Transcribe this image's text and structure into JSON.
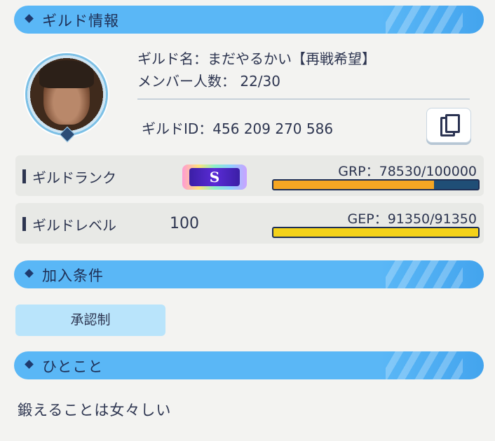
{
  "sections": {
    "guild_info_title": "ギルド情報",
    "join_condition_title": "加入条件",
    "comment_title": "ひとこと"
  },
  "guild": {
    "name_line": "ギルド名：まだやるかい【再戦希望】",
    "members_line": "メンバー人数： 22/30",
    "id_line": "ギルドID：456 209 270 586"
  },
  "rank": {
    "label": "ギルドランク",
    "badge_letter": "S",
    "gauge_text": "GRP：78530/100000",
    "progress": 0.7853,
    "fill_color": "#f5a623"
  },
  "level": {
    "label": "ギルドレベル",
    "value": "100",
    "gauge_text": "GEP：91350/91350",
    "progress": 1.0,
    "fill_color": "#f3d21b"
  },
  "join_condition": {
    "value": "承認制"
  },
  "comment": {
    "text": "鍛えることは女々しい"
  },
  "icons": {
    "copy": "copy-icon",
    "portrait": "guild-leader-portrait"
  },
  "colors": {
    "header": "#5ab7f6",
    "chip": "#b9e4fb",
    "text": "#2d3550"
  }
}
